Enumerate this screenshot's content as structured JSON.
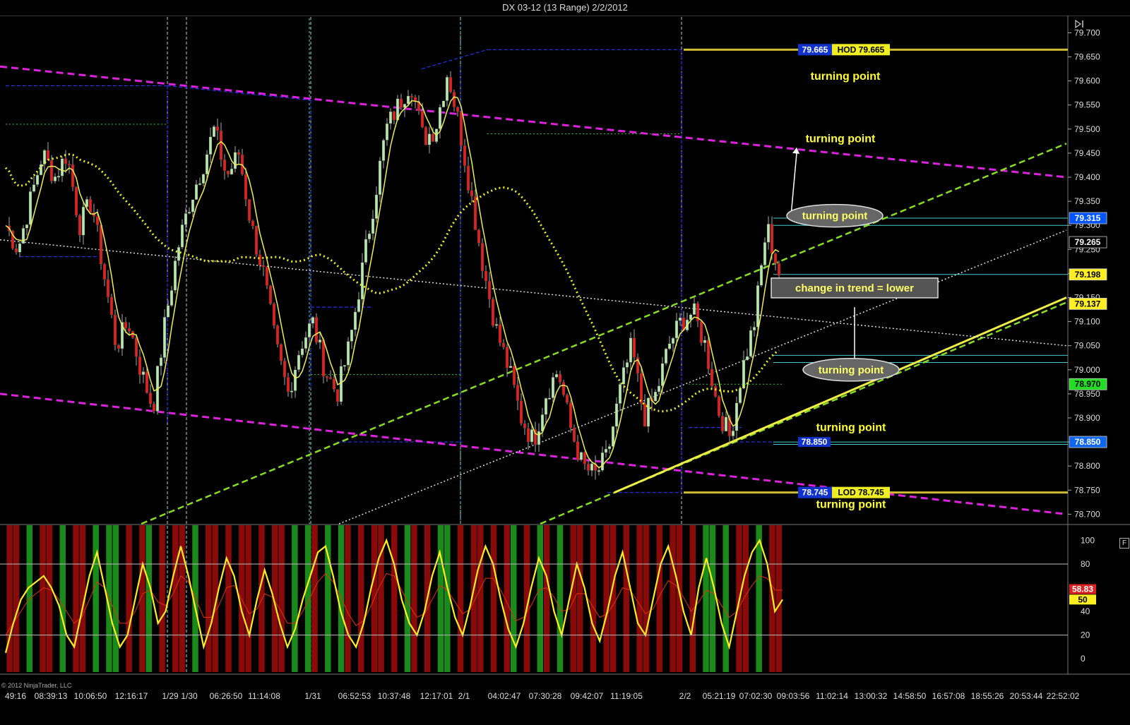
{
  "window": {
    "title": "DX 03-12 (13 Range)  2/2/2012",
    "copyright": "© 2012 NinjaTrader, LLC",
    "panel_button": "F"
  },
  "chart_data": [
    {
      "type": "candlestick",
      "instrument": "DX 03-12",
      "bar_type": "13 Range",
      "title": "DX 03-12 (13 Range)  2/2/2012",
      "ylim": [
        78.68,
        79.73
      ],
      "y_ticks": [
        79.7,
        79.65,
        79.6,
        79.55,
        79.5,
        79.45,
        79.4,
        79.35,
        79.3,
        79.25,
        79.2,
        79.15,
        79.1,
        79.05,
        79.0,
        78.95,
        78.9,
        78.85,
        78.8,
        78.75,
        78.7
      ],
      "y_tick_labels": [
        "79.700",
        "79.650",
        "79.600",
        "79.550",
        "79.500",
        "79.450",
        "79.400",
        "79.350",
        "79.300",
        "79.250",
        "79.200",
        "79.150",
        "79.100",
        "79.050",
        "79.000",
        "78.950",
        "78.900",
        "78.850",
        "78.800",
        "78.750",
        "78.700"
      ],
      "x_tick_labels": [
        "49:16",
        "08:39:13",
        "10:06:50",
        "12:16:17",
        "1/29",
        "1/30",
        "06:26:50",
        "11:14:08",
        "1/31",
        "06:52:53",
        "10:37:48",
        "12:17:01",
        "2/1",
        "04:02:47",
        "07:30:28",
        "09:42:07",
        "11:19:05",
        "2/2",
        "05:21:19",
        "07:02:30",
        "09:03:56",
        "11:02:14",
        "13:00:32",
        "14:58:50",
        "16:57:08",
        "18:55:26",
        "20:53:44",
        "22:52:02"
      ],
      "session_separators": [
        "1/29",
        "1/30",
        "1/31",
        "2/1",
        "2/2"
      ],
      "close_path": [
        79.3,
        79.25,
        79.35,
        79.45,
        79.4,
        79.45,
        79.3,
        79.35,
        79.2,
        79.05,
        79.1,
        79.0,
        78.92,
        79.1,
        79.25,
        79.35,
        79.42,
        79.5,
        79.4,
        79.45,
        79.3,
        79.2,
        79.05,
        78.95,
        79.05,
        79.1,
        79.0,
        78.95,
        79.05,
        79.2,
        79.35,
        79.5,
        79.55,
        79.6,
        79.48,
        79.5,
        79.62,
        79.5,
        79.35,
        79.2,
        79.08,
        79.0,
        78.9,
        78.85,
        78.95,
        79.0,
        78.88,
        78.8,
        78.78,
        78.82,
        78.95,
        79.05,
        78.9,
        78.95,
        79.05,
        79.1,
        79.12,
        79.05,
        78.92,
        78.86,
        79.0,
        79.1,
        79.3,
        79.2
      ],
      "price_levels": [
        {
          "label": "79.665",
          "type": "high-of-day",
          "text": "HOD 79.665"
        },
        {
          "label": "79.315",
          "color": "#0055ff"
        },
        {
          "label": "79.265",
          "color": "#000000"
        },
        {
          "label": "79.198",
          "color": "#ffee22"
        },
        {
          "label": "79.137",
          "color": "#ffee22"
        },
        {
          "label": "78.970",
          "color": "#22dd22"
        },
        {
          "label": "78.850",
          "color": "#1166ee"
        },
        {
          "label": "78.745",
          "type": "low-of-day",
          "text": "LOD 78.745"
        }
      ],
      "line_label": "78.850",
      "annotations": [
        {
          "text": "turning point",
          "style": "plain",
          "near": "79.665"
        },
        {
          "text": "turning point",
          "style": "plain",
          "near": "79.48"
        },
        {
          "text": "turning point",
          "style": "ellipse",
          "near": "79.32"
        },
        {
          "text": "change in trend = lower",
          "style": "box",
          "near": "79.17"
        },
        {
          "text": "turning point",
          "style": "ellipse",
          "near": "79.00"
        },
        {
          "text": "turning point",
          "style": "plain",
          "near": "78.88"
        },
        {
          "text": "turning point",
          "style": "plain",
          "near": "78.72"
        }
      ],
      "grid": false
    },
    {
      "type": "line",
      "name": "oscillator",
      "ylim": [
        -10,
        108
      ],
      "y_ticks": [
        100,
        80,
        60,
        40,
        20,
        0
      ],
      "y_tick_labels": [
        "100",
        "80",
        "60",
        "40",
        "20",
        "0"
      ],
      "reference_lines": [
        80,
        20
      ],
      "current_values": [
        {
          "label": "58.83",
          "color": "#dd2222"
        },
        {
          "label": "50",
          "color": "#ffee22"
        }
      ],
      "fast_line": [
        5,
        30,
        50,
        60,
        65,
        70,
        60,
        45,
        20,
        10,
        40,
        70,
        90,
        60,
        30,
        10,
        20,
        50,
        80,
        60,
        30,
        40,
        70,
        95,
        70,
        40,
        10,
        30,
        60,
        85,
        70,
        40,
        20,
        50,
        75,
        55,
        30,
        10,
        25,
        50,
        70,
        90,
        95,
        70,
        40,
        20,
        10,
        30,
        60,
        85,
        100,
        80,
        50,
        30,
        20,
        40,
        70,
        90,
        60,
        35,
        20,
        45,
        75,
        95,
        80,
        50,
        25,
        10,
        30,
        60,
        85,
        70,
        40,
        20,
        50,
        80,
        60,
        30,
        15,
        40,
        70,
        90,
        60,
        30,
        20,
        50,
        80,
        95,
        70,
        40,
        20,
        60,
        85,
        60,
        30,
        10,
        40,
        70,
        90,
        100,
        80,
        40,
        50
      ],
      "slow_line": [
        20,
        30,
        40,
        50,
        55,
        60,
        58,
        50,
        40,
        30,
        35,
        50,
        65,
        60,
        45,
        30,
        30,
        40,
        55,
        58,
        48,
        45,
        55,
        70,
        65,
        50,
        35,
        35,
        45,
        60,
        62,
        50,
        38,
        42,
        55,
        52,
        42,
        30,
        30,
        40,
        52,
        65,
        72,
        65,
        52,
        38,
        28,
        32,
        45,
        60,
        72,
        70,
        58,
        45,
        35,
        38,
        50,
        62,
        58,
        48,
        38,
        42,
        55,
        68,
        68,
        58,
        45,
        32,
        35,
        45,
        58,
        60,
        52,
        40,
        42,
        55,
        55,
        45,
        35,
        38,
        48,
        60,
        58,
        48,
        38,
        42,
        55,
        66,
        62,
        52,
        40,
        48,
        58,
        55,
        45,
        35,
        40,
        52,
        62,
        70,
        68,
        58,
        58
      ],
      "histogram": "GRRRGGRRGGRRRGGRGGRRRRGGRRRRGGGRRRRRRRGRRRRGGRGRRGGGRGRRRRRRRGRRRRGGGRRRRRRRRGRRRGRGGRRRRRRRRRRGRRGRRRRRRRGGGGRRRRGRRR"
    }
  ]
}
